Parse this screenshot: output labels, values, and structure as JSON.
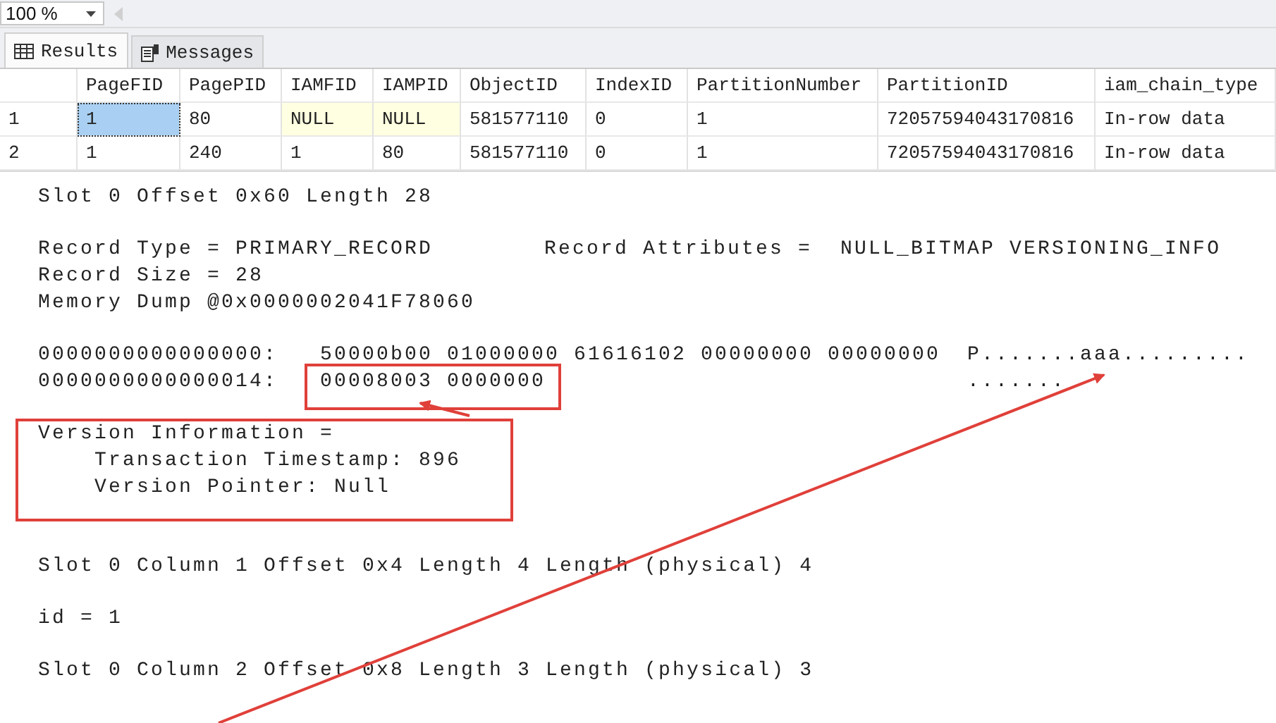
{
  "zoom": {
    "value": "100 %"
  },
  "tabs": [
    {
      "label": "Results",
      "kind": "grid",
      "selected": true
    },
    {
      "label": "Messages",
      "kind": "document",
      "selected": false
    }
  ],
  "grid": {
    "columns": [
      "PageFID",
      "PagePID",
      "IAMFID",
      "IAMPID",
      "ObjectID",
      "IndexID",
      "PartitionNumber",
      "PartitionID",
      "iam_chain_type"
    ],
    "rows": [
      {
        "number": "1",
        "cells": [
          {
            "text": "1",
            "kind": "value",
            "selected": true
          },
          {
            "text": "80",
            "kind": "value",
            "selected": false
          },
          {
            "text": "NULL",
            "kind": "null",
            "selected": false
          },
          {
            "text": "NULL",
            "kind": "null",
            "selected": false
          },
          {
            "text": "581577110",
            "kind": "value",
            "selected": false
          },
          {
            "text": "0",
            "kind": "value",
            "selected": false
          },
          {
            "text": "1",
            "kind": "value",
            "selected": false
          },
          {
            "text": "72057594043170816",
            "kind": "value",
            "selected": false
          },
          {
            "text": "In-row data",
            "kind": "value",
            "selected": false
          }
        ]
      },
      {
        "number": "2",
        "cells": [
          {
            "text": "1",
            "kind": "value",
            "selected": false
          },
          {
            "text": "240",
            "kind": "value",
            "selected": false
          },
          {
            "text": "1",
            "kind": "value",
            "selected": false
          },
          {
            "text": "80",
            "kind": "value",
            "selected": false
          },
          {
            "text": "581577110",
            "kind": "value",
            "selected": false
          },
          {
            "text": "0",
            "kind": "value",
            "selected": false
          },
          {
            "text": "1",
            "kind": "value",
            "selected": false
          },
          {
            "text": "72057594043170816",
            "kind": "value",
            "selected": false
          },
          {
            "text": "In-row data",
            "kind": "value",
            "selected": false
          }
        ]
      }
    ]
  },
  "messages": [
    {
      "kind": "plain",
      "lines": [
        {
          "kind": "text",
          "text": "Slot 0 Offset 0x60 Length 28"
        }
      ]
    },
    {
      "kind": "plain",
      "lines": [
        {
          "kind": "split",
          "text": "Record Type = PRIMARY_RECORD",
          "aside": "Record Attributes =  NULL_BITMAP VERSIONING_INFO"
        },
        {
          "kind": "text",
          "text": "Record Size = 28"
        },
        {
          "kind": "text",
          "text": "Memory Dump @0x0000002041F78060"
        }
      ]
    },
    {
      "kind": "plain",
      "lines": [
        {
          "kind": "hex",
          "offset": "0000000000000000:",
          "bytes": "50000b00 01000000 61616102 00000000 00000000",
          "ascii": "P.......aaa........."
        },
        {
          "kind": "hex",
          "offset": "0000000000000014:",
          "bytes": "00008003 0000000",
          "ascii": "......."
        }
      ]
    },
    {
      "kind": "boxed",
      "lines": [
        {
          "kind": "text",
          "text": "Version Information ="
        },
        {
          "kind": "indented",
          "text": "Transaction Timestamp: 896"
        },
        {
          "kind": "indented",
          "text": "Version Pointer: Null"
        }
      ]
    },
    {
      "kind": "plain",
      "lines": [
        {
          "kind": "text",
          "text": "Slot 0 Column 1 Offset 0x4 Length 4 Length (physical) 4"
        }
      ]
    },
    {
      "kind": "plain",
      "lines": [
        {
          "kind": "text",
          "text": "id = 1"
        }
      ]
    },
    {
      "kind": "plain",
      "lines": [
        {
          "kind": "text",
          "text": "Slot 0 Column 2 Offset 0x8 Length 3 Length (physical) 3"
        }
      ]
    }
  ]
}
